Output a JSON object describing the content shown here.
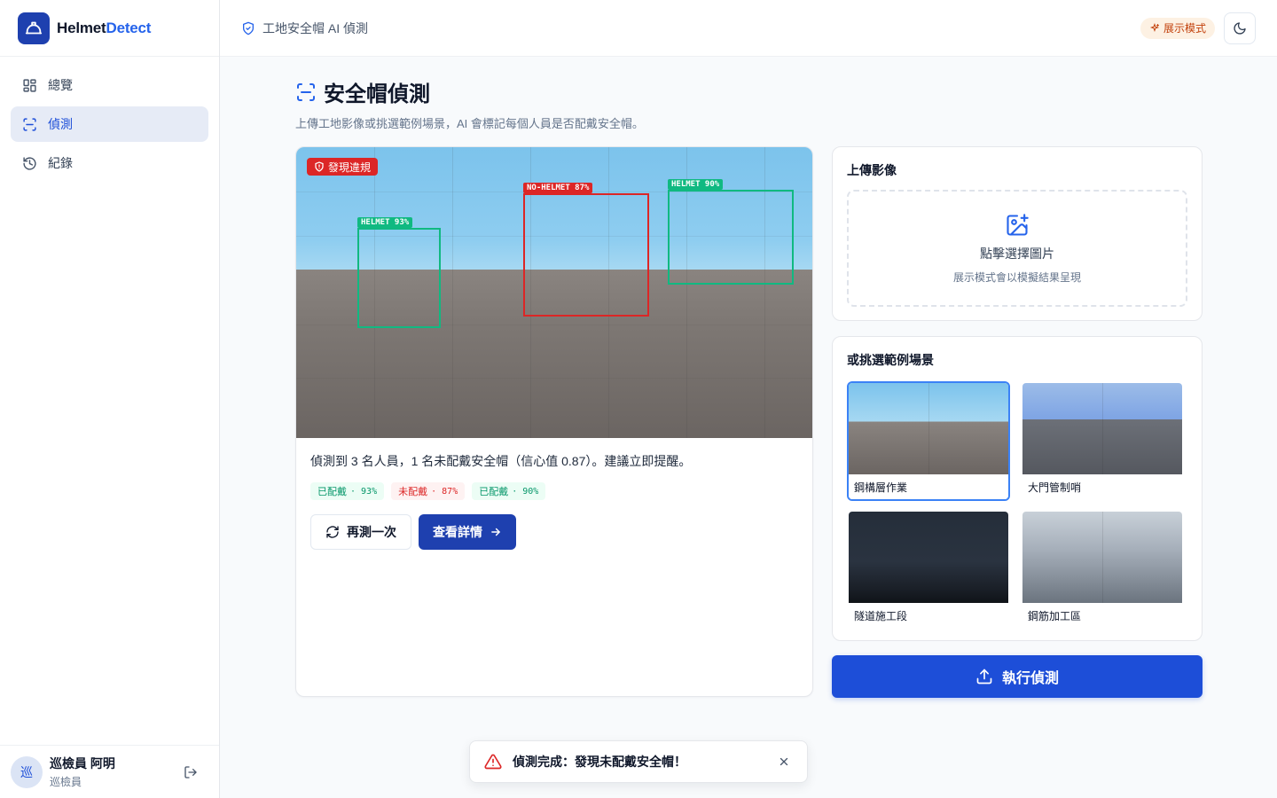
{
  "brand": {
    "name_part1": "Helmet",
    "name_part2": "Detect"
  },
  "nav": [
    {
      "label": "總覽",
      "icon": "grid-icon",
      "active": false
    },
    {
      "label": "偵測",
      "icon": "scan-icon",
      "active": true
    },
    {
      "label": "紀錄",
      "icon": "history-icon",
      "active": false
    }
  ],
  "user": {
    "avatar_char": "巡",
    "name": "巡檢員 阿明",
    "role": "巡檢員"
  },
  "topbar": {
    "title": "工地安全帽 AI 偵測",
    "demo_badge": "展示模式"
  },
  "page": {
    "title": "安全帽偵測",
    "subtitle": "上傳工地影像或挑選範例場景，AI 會標記每個人員是否配戴安全帽。"
  },
  "result": {
    "violation_badge": "發現違規",
    "detections": [
      {
        "label": "HELMET 93%",
        "status": "ok"
      },
      {
        "label": "NO-HELMET 87%",
        "status": "bad"
      },
      {
        "label": "HELMET 90%",
        "status": "ok"
      }
    ],
    "summary": "偵測到 3 名人員，1 名未配戴安全帽（信心值 0.87）。建議立即提醒。",
    "chips": [
      {
        "text": "已配戴",
        "value": "· 93%",
        "status": "ok"
      },
      {
        "text": "未配戴",
        "value": "· 87%",
        "status": "bad"
      },
      {
        "text": "已配戴",
        "value": "· 90%",
        "status": "ok"
      }
    ],
    "retry_label": "再測一次",
    "details_label": "查看詳情"
  },
  "upload": {
    "title": "上傳影像",
    "dz_title": "點擊選擇圖片",
    "dz_sub": "展示模式會以模擬結果呈現"
  },
  "samples": {
    "title": "或挑選範例場景",
    "items": [
      {
        "label": "鋼構層作業",
        "selected": true
      },
      {
        "label": "大門管制哨",
        "selected": false
      },
      {
        "label": "隧道施工段",
        "selected": false
      },
      {
        "label": "鋼筋加工區",
        "selected": false
      }
    ]
  },
  "run_label": "執行偵測",
  "toast": {
    "text": "偵測完成：發現未配戴安全帽！"
  },
  "colors": {
    "primary": "#1e40af",
    "accent": "#2563eb",
    "ok": "#10b981",
    "danger": "#dc2626",
    "warning_badge": "#c2410c"
  }
}
